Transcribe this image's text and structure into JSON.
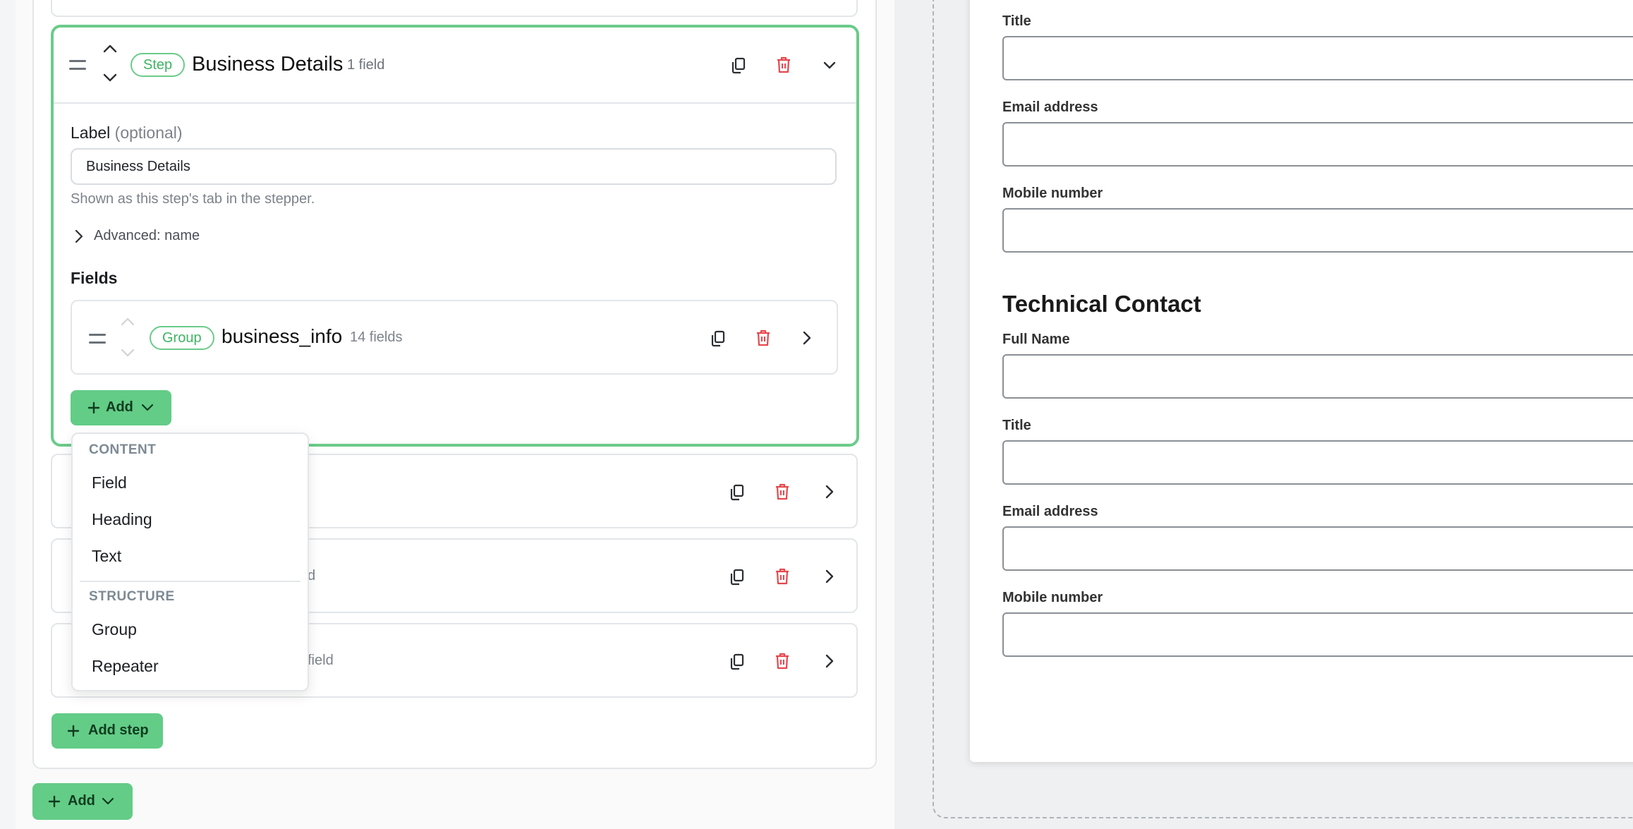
{
  "step": {
    "badge": "Step",
    "title": "Business Details",
    "count": "1 field",
    "label_text": "Label",
    "label_optional": "(optional)",
    "label_value": "Business Details",
    "help": "Shown as this step's tab in the stepper.",
    "advanced": "Advanced: name",
    "fields_heading": "Fields",
    "group": {
      "badge": "Group",
      "name": "business_info",
      "count": "14 fields"
    },
    "add_label": "Add"
  },
  "add_menu": {
    "content_heading": "CONTENT",
    "content_items": [
      "Field",
      "Heading",
      "Text"
    ],
    "structure_heading": "STRUCTURE",
    "structure_items": [
      "Group",
      "Repeater"
    ]
  },
  "collapsed_steps": [
    {
      "partial_count": "d"
    },
    {
      "partial_count": "field"
    }
  ],
  "add_step_label": "Add step",
  "bottom_add_label": "Add",
  "preview": {
    "fields_top": [
      "Title",
      "Email address",
      "Mobile number"
    ],
    "section_heading": "Technical Contact",
    "fields_bottom": [
      "Full Name",
      "Title",
      "Email address",
      "Mobile number"
    ]
  },
  "colors": {
    "accent": "#63cc87",
    "danger": "#e5484d"
  }
}
